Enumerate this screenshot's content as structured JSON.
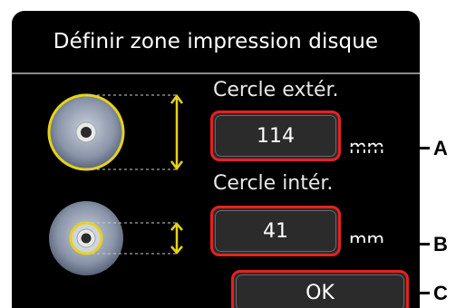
{
  "screen": {
    "title": "Définir zone impression disque"
  },
  "outer_circle": {
    "label": "Cercle extér.",
    "value": "114",
    "unit": "mm"
  },
  "inner_circle": {
    "label": "Cercle intér.",
    "value": "41",
    "unit": "mm"
  },
  "ok_button": {
    "label": "OK"
  },
  "callouts": {
    "a": "A",
    "b": "B",
    "c": "C"
  },
  "colors": {
    "highlight_border": "#e82020",
    "indicator_yellow": "#e6d21a",
    "screen_background": "#000000"
  }
}
